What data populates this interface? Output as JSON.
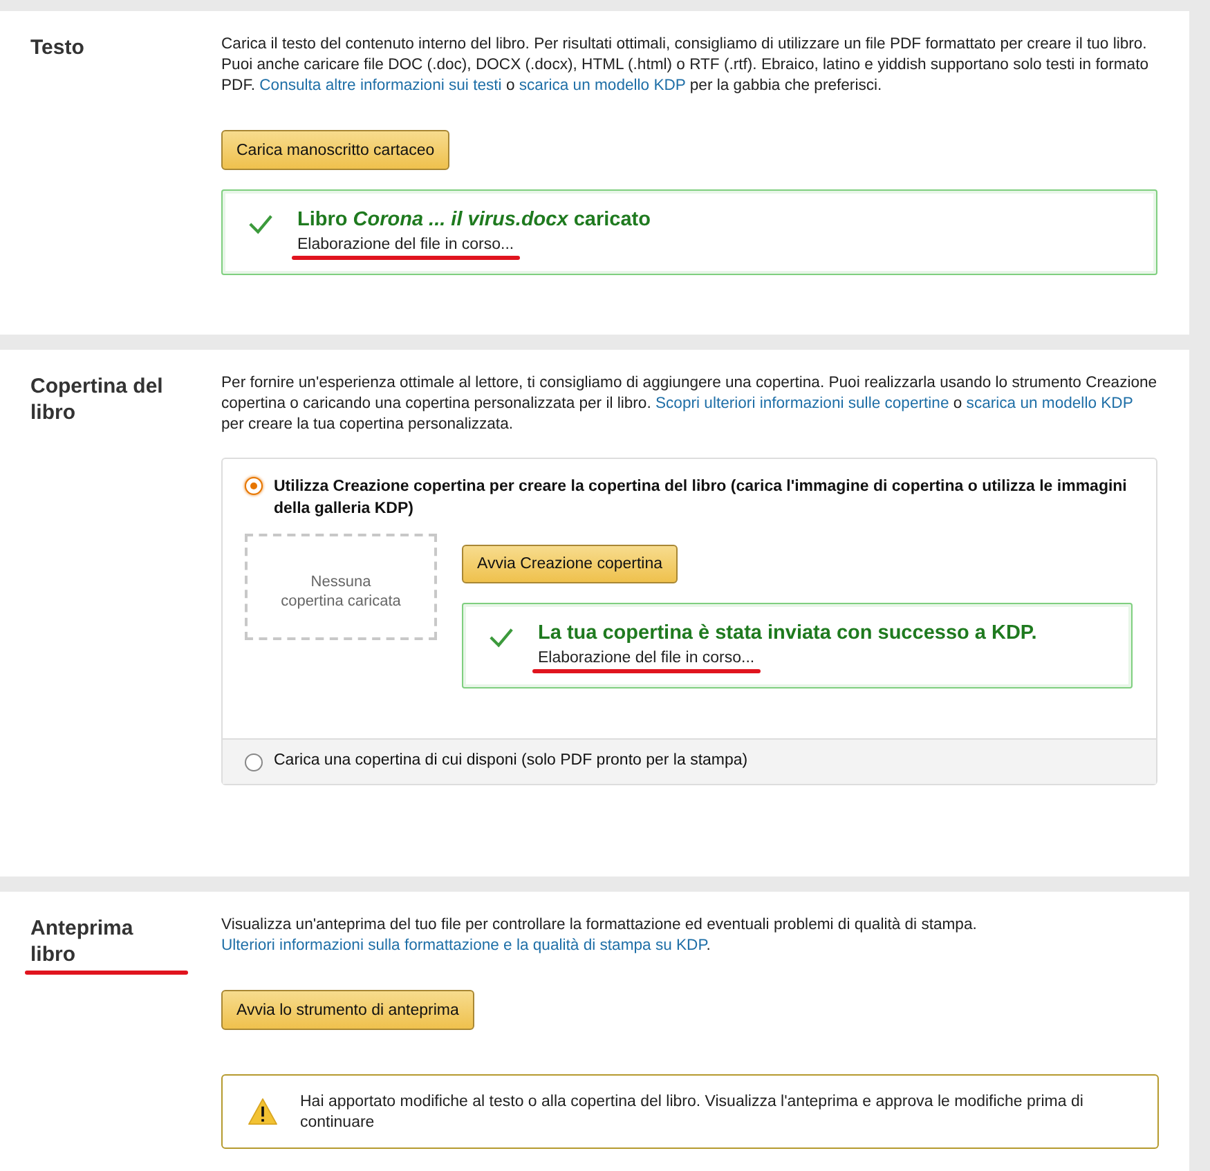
{
  "sections": [
    {
      "title": "Testo",
      "title_underlined": false,
      "description": [
        {
          "kind": "text",
          "text": "Carica il testo del contenuto interno del libro. Per risultati ottimali, consigliamo di utilizzare un file PDF formattato per creare il tuo libro. Puoi anche caricare file DOC (.doc), DOCX (.docx), HTML (.html) o RTF (.rtf). Ebraico, latino e yiddish supportano solo testi in formato PDF. "
        },
        {
          "kind": "link",
          "text": "Consulta altre informazioni sui testi"
        },
        {
          "kind": "text",
          "text": " o "
        },
        {
          "kind": "link",
          "text": "scarica un modello KDP"
        },
        {
          "kind": "text",
          "text": " per la gabbia che preferisci."
        }
      ],
      "button": "Carica manoscritto cartaceo",
      "success": {
        "title": "Libro *Corona ... il virus.docx* caricato",
        "status": "Elaborazione del file in corso...",
        "status_underlined": true
      }
    },
    {
      "title": "Copertina del libro",
      "title_underlined": false,
      "description": [
        {
          "kind": "text",
          "text": "Per fornire un'esperienza ottimale al lettore, ti consigliamo di aggiungere una copertina. Puoi realizzarla usando lo strumento Creazione copertina o caricando una copertina personalizzata per il libro. "
        },
        {
          "kind": "link",
          "text": "Scopri ulteriori informazioni sulle copertine"
        },
        {
          "kind": "text",
          "text": " o "
        },
        {
          "kind": "link",
          "text": "scarica un modello KDP"
        },
        {
          "kind": "text",
          "text": " per creare la tua copertina personalizzata."
        }
      ],
      "cover_options": [
        {
          "label": "Utilizza Creazione copertina per creare la copertina del libro (carica l'immagine di copertina o utilizza le immagini della galleria KDP)",
          "selected": true,
          "placeholder_text": "Nessuna copertina caricata",
          "button": "Avvia Creazione copertina",
          "success": {
            "title": "La tua copertina è stata inviata con successo a KDP.",
            "status": "Elaborazione del file in corso...",
            "status_underlined": true
          }
        },
        {
          "label": "Carica una copertina di cui disponi (solo PDF pronto per la stampa)",
          "selected": false
        }
      ]
    },
    {
      "title": "Anteprima libro",
      "title_underlined": true,
      "description": [
        {
          "kind": "text",
          "text": "Visualizza un'anteprima del tuo file per controllare la formattazione ed eventuali problemi di qualità di stampa. "
        },
        {
          "kind": "link",
          "text": "Ulteriori informazioni sulla formattazione e la qualità di stampa su KDP"
        },
        {
          "kind": "text",
          "text": "."
        }
      ],
      "button": "Avvia lo strumento di anteprima",
      "warning": "Hai apportato modifiche al testo o alla copertina del libro. Visualizza l'anteprima e approva le modifiche prima di continuare"
    }
  ]
}
